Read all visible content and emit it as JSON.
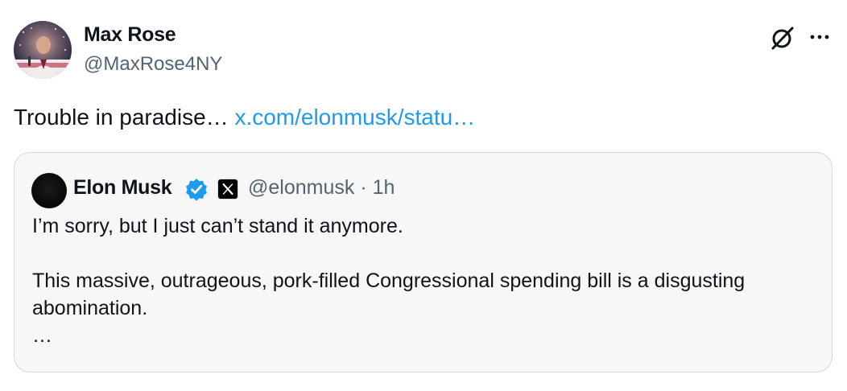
{
  "author": {
    "name": "Max Rose",
    "handle": "@MaxRose4NY"
  },
  "tweet": {
    "text": "Trouble in paradise…",
    "link": "x.com/elonmusk/statu…"
  },
  "quote": {
    "name": "Elon Musk",
    "handle": "@elonmusk",
    "separator": "·",
    "time": "1h",
    "line1": "I’m sorry, but I just can’t stand it anymore.",
    "line2": "This massive, outrageous, pork-filled Congressional spending bill is a disgusting abomination.",
    "ellipsis": "…"
  },
  "icons": {
    "grok": "grok-icon",
    "more": "more-icon",
    "verified": "verified-badge-icon",
    "x_logo": "x-logo-icon"
  },
  "colors": {
    "link": "#1d9bf0",
    "secondary_text": "#536471",
    "verified": "#1d9bf0",
    "quote_bg": "#f7f7f7"
  }
}
